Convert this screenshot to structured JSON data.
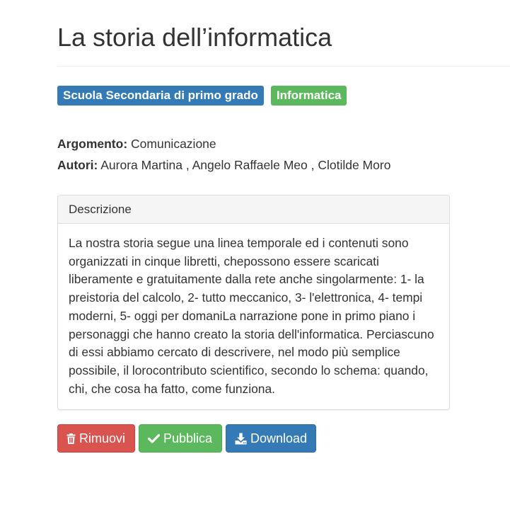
{
  "title": "La storia dell’informatica",
  "badges": {
    "level": "Scuola Secondaria di primo grado",
    "subject": "Informatica"
  },
  "meta": {
    "argomento_label": "Argomento:",
    "argomento_value": " Comunicazione",
    "autori_label": "Autori:",
    "autori_value": " Aurora Martina , Angelo Raffaele Meo , Clotilde Moro"
  },
  "panel": {
    "heading": "Descrizione",
    "body": "La nostra storia segue una linea temporale ed i contenuti sono organizzati in cinque libretti, chepossono essere scaricati liberamente e gratuitamente dalla rete anche singolarmente: 1- la preistoria del calcolo, 2- tutto meccanico, 3- l'elettronica, 4- tempi moderni, 5- oggi per domaniLa narrazione pone in primo piano i personaggi che hanno creato la storia dell'informatica. Perciascuno di essi abbiamo cercato di descrivere, nel modo più semplice possibile, il lorocontributo scientifico, secondo lo schema: quando, chi, che cosa ha fatto, come funziona."
  },
  "buttons": {
    "remove": {
      "label": "Rimuovi",
      "icon": "trash-icon",
      "color": "#d9534f"
    },
    "publish": {
      "label": "Pubblica",
      "icon": "check-icon",
      "color": "#5cb85c"
    },
    "download": {
      "label": "Download",
      "icon": "download-icon",
      "color": "#337ab7"
    }
  },
  "colors": {
    "primary": "#337ab7",
    "success": "#5cb85c",
    "danger": "#d9534f",
    "text": "#333333"
  }
}
